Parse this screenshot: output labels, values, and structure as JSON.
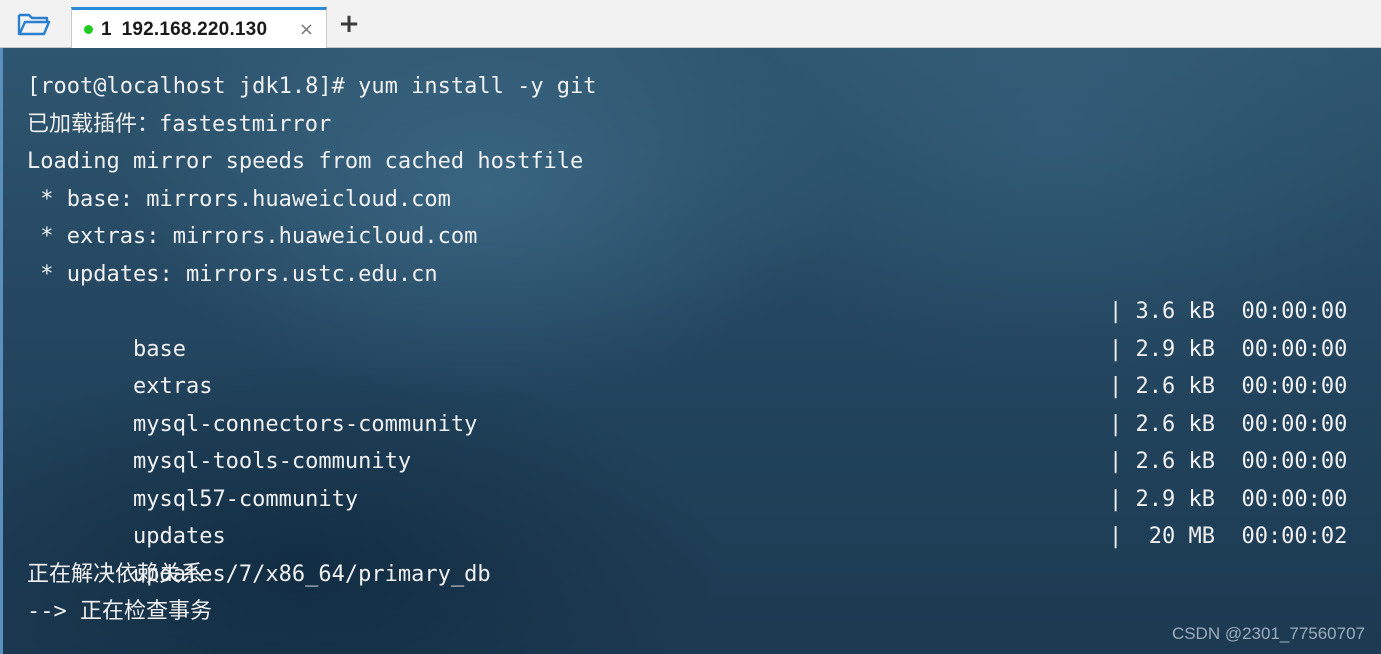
{
  "tabbar": {
    "tab": {
      "index": "1",
      "title": "192.168.220.130",
      "close": "×",
      "status_color": "#22cc22"
    },
    "new_tab": "+"
  },
  "terminal": {
    "lines": [
      "[root@localhost jdk1.8]# yum install -y git",
      "已加载插件：fastestmirror",
      "Loading mirror speeds from cached hostfile",
      " * base: mirrors.huaweicloud.com",
      " * extras: mirrors.huaweicloud.com",
      " * updates: mirrors.ustc.edu.cn"
    ],
    "repos": [
      {
        "name": "base",
        "size": "| 3.6 kB  00:00:00"
      },
      {
        "name": "extras",
        "size": "| 2.9 kB  00:00:00"
      },
      {
        "name": "mysql-connectors-community",
        "size": "| 2.6 kB  00:00:00"
      },
      {
        "name": "mysql-tools-community",
        "size": "| 2.6 kB  00:00:00"
      },
      {
        "name": "mysql57-community",
        "size": "| 2.6 kB  00:00:00"
      },
      {
        "name": "updates",
        "size": "| 2.9 kB  00:00:00"
      },
      {
        "name": "updates/7/x86_64/primary_db",
        "size": "|  20 MB  00:00:02"
      }
    ],
    "tail": [
      "正在解决依赖关系",
      "--> 正在检查事务"
    ]
  },
  "watermark": "CSDN @2301_77560707",
  "colors": {
    "accent": "#2a8ad8",
    "folder_icon": "#2a7fd0"
  }
}
